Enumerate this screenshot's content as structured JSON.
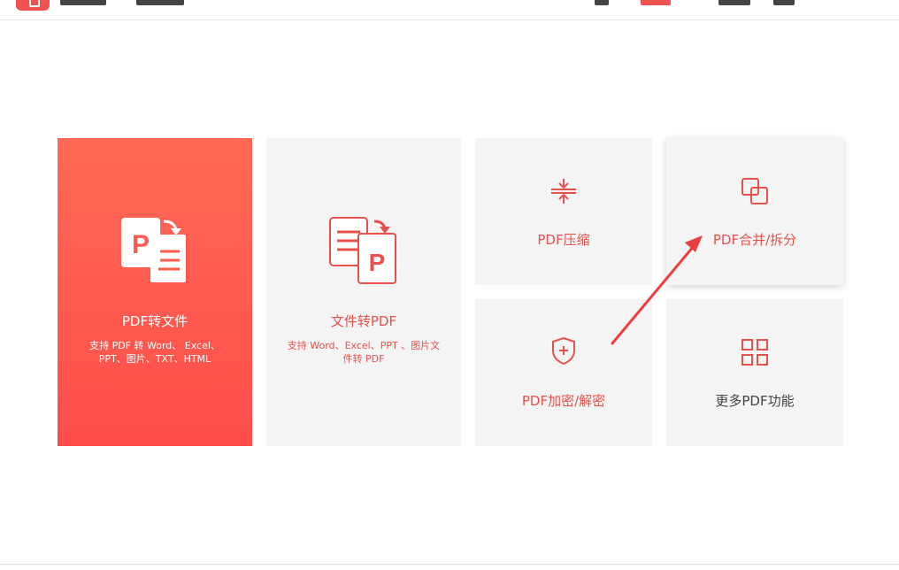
{
  "colors": {
    "accent": "#e8504c",
    "card_bg": "#f4f4f4",
    "red_gradient_top": "#ff6a55",
    "red_gradient_bottom": "#ff4d4a",
    "annotation_arrow": "#e8403c"
  },
  "cards": {
    "pdf_to_file": {
      "title": "PDF转文件",
      "desc_line1": "支持 PDF 转 Word、 Excel、",
      "desc_line2": "PPT、图片、TXT、HTML",
      "icon": "pdf-to-file-icon"
    },
    "file_to_pdf": {
      "title": "文件转PDF",
      "desc_line1": "支持 Word、Excel、PPT 、图片文",
      "desc_line2": "件转 PDF",
      "icon": "file-to-pdf-icon"
    },
    "compress": {
      "title": "PDF压缩",
      "icon": "compress-icon"
    },
    "merge_split": {
      "title": "PDF合并/拆分",
      "icon": "merge-icon"
    },
    "encrypt": {
      "title": "PDF加密/解密",
      "icon": "shield-plus-icon"
    },
    "more": {
      "title": "更多PDF功能",
      "icon": "grid-icon"
    }
  }
}
